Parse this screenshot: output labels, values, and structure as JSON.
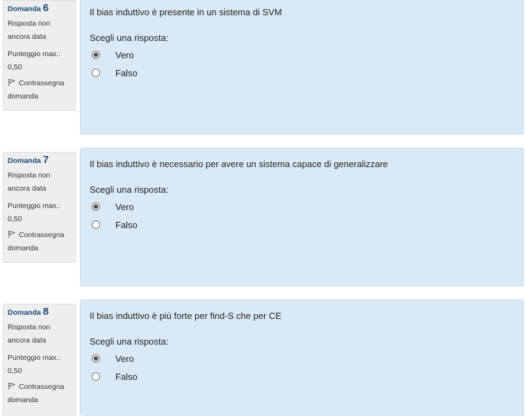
{
  "questions": [
    {
      "label": "Domanda",
      "number": "6",
      "status_line1": "Risposta non",
      "status_line2": "ancora data",
      "points_label": "Punteggio max.:",
      "points_value": "0,50",
      "flag_line1": "Contrassegna",
      "flag_line2": "domanda",
      "text": "Il bias induttivo è presente in un sistema di SVM",
      "prompt": "Scegli una risposta:",
      "options": [
        {
          "label": "Vero",
          "selected": true
        },
        {
          "label": "Falso",
          "selected": false
        }
      ]
    },
    {
      "label": "Domanda",
      "number": "7",
      "status_line1": "Risposta non",
      "status_line2": "ancora data",
      "points_label": "Punteggio max.:",
      "points_value": "0,50",
      "flag_line1": "Contrassegna",
      "flag_line2": "domanda",
      "text": "Il bias induttivo è necessario per avere un sistema capace di generalizzare",
      "prompt": "Scegli una risposta:",
      "options": [
        {
          "label": "Vero",
          "selected": true
        },
        {
          "label": "Falso",
          "selected": false
        }
      ]
    },
    {
      "label": "Domanda",
      "number": "8",
      "status_line1": "Risposta non",
      "status_line2": "ancora data",
      "points_label": "Punteggio max.:",
      "points_value": "0,50",
      "flag_line1": "Contrassegna",
      "flag_line2": "domanda",
      "text": "Il bias induttivo è più forte per find-S che per CE",
      "prompt": "Scegli una risposta:",
      "options": [
        {
          "label": "Vero",
          "selected": true
        },
        {
          "label": "Falso",
          "selected": false
        }
      ]
    }
  ],
  "colors": {
    "content_bg": "#d9e9f5",
    "info_bg": "#eeeeee",
    "question_number": "#1b4a7a"
  },
  "icons": {
    "flag": "flag-icon"
  }
}
